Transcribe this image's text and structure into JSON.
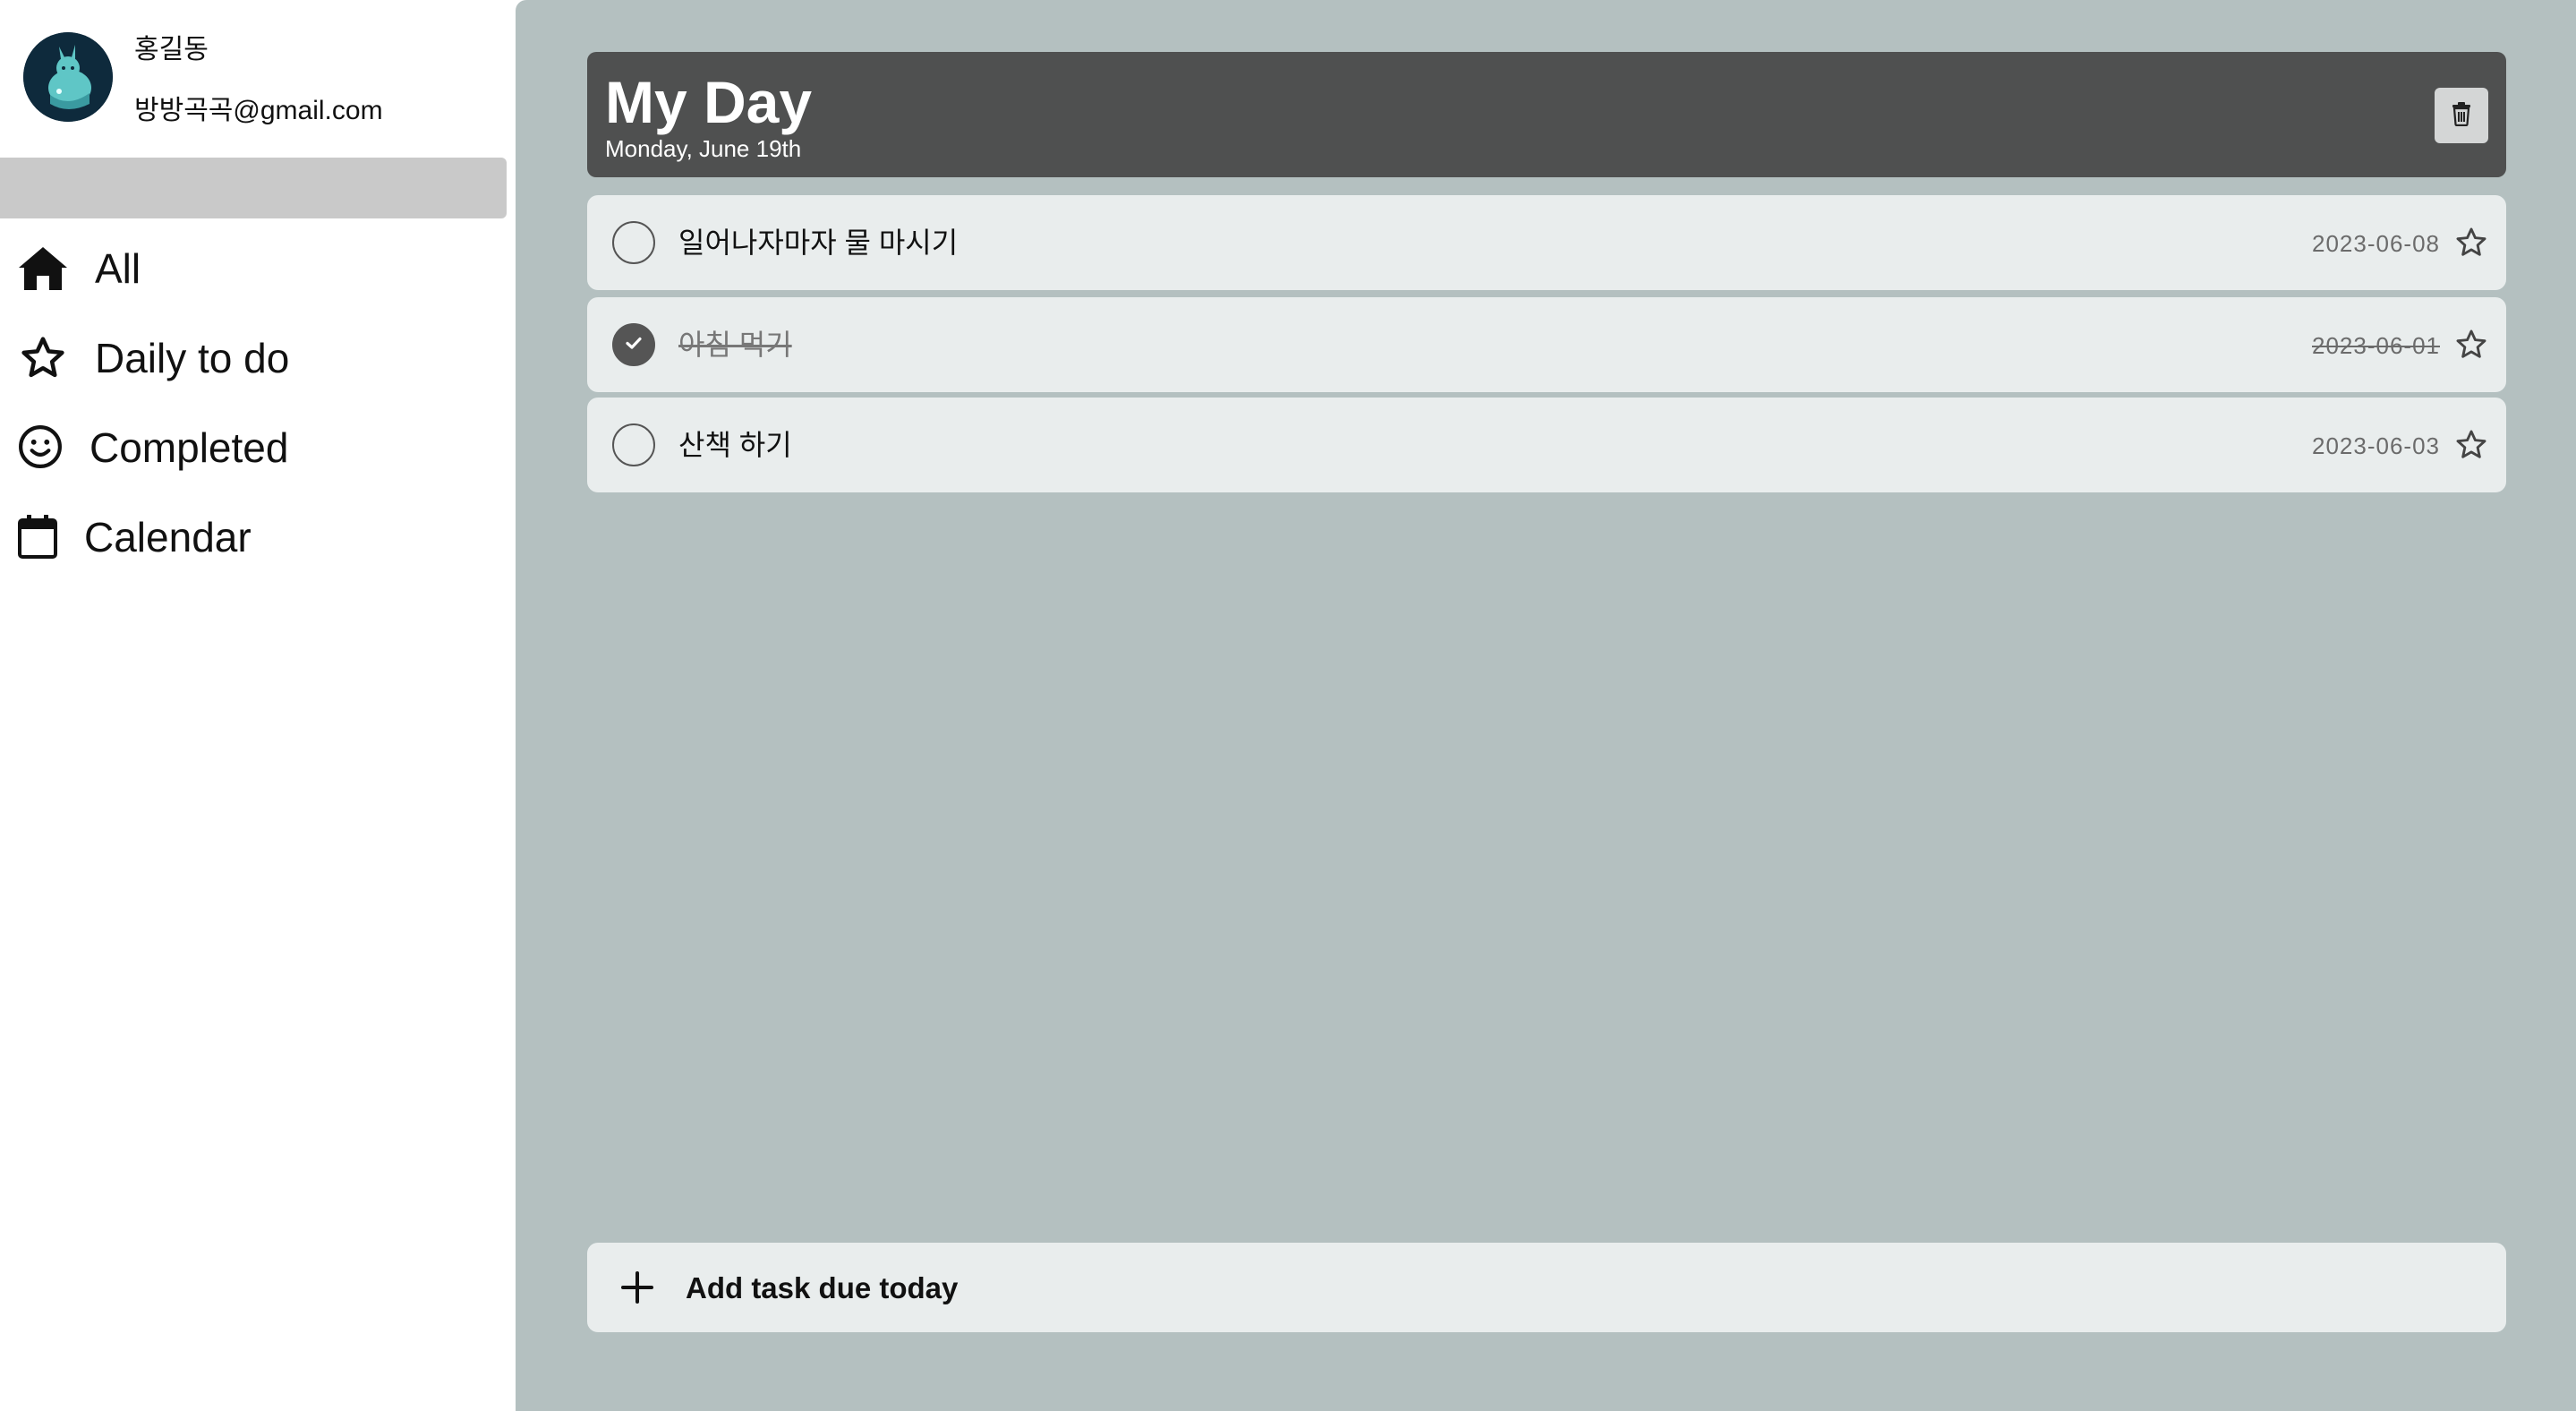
{
  "profile": {
    "name": "홍길동",
    "email": "방방곡곡@gmail.com"
  },
  "sidebar": {
    "items": [
      {
        "label": "All",
        "icon": "home-icon"
      },
      {
        "label": "Daily to do",
        "icon": "star-icon"
      },
      {
        "label": "Completed",
        "icon": "smiley-icon"
      },
      {
        "label": "Calendar",
        "icon": "calendar-icon"
      }
    ]
  },
  "header": {
    "title": "My Day",
    "date": "Monday, June 19th"
  },
  "tasks": [
    {
      "text": "일어나자마자 물 마시기",
      "date": "2023-06-08",
      "completed": false,
      "starred": false
    },
    {
      "text": "아침 먹기",
      "date": "2023-06-01",
      "completed": true,
      "starred": false
    },
    {
      "text": "산책 하기",
      "date": "2023-06-03",
      "completed": false,
      "starred": false
    }
  ],
  "add_task": {
    "label": "Add task due today"
  },
  "colors": {
    "main_bg": "#b4c0c0",
    "header_bg": "#4f5050",
    "task_bg": "#e9eded",
    "sidebar_search_bg": "#c9c9c9"
  }
}
